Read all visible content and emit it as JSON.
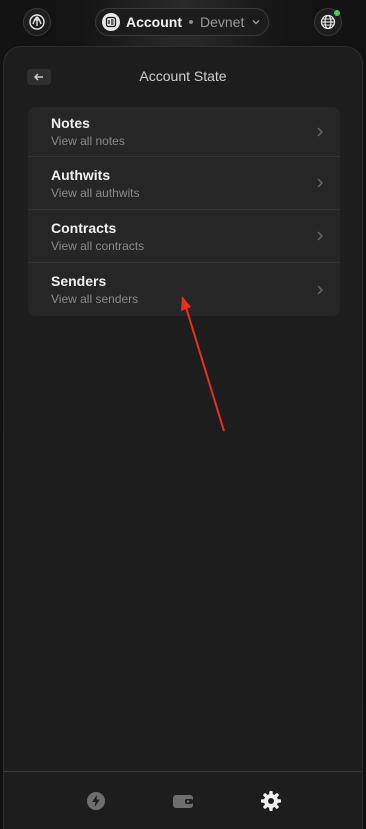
{
  "topbar": {
    "account_label": "Account",
    "network_label": "Devnet",
    "logo_icon": "aztec-logo-icon",
    "globe_icon": "globe-icon",
    "status_color": "#3ecf5c"
  },
  "panel": {
    "title": "Account State",
    "back_icon": "arrow-left-icon"
  },
  "menu": {
    "items": [
      {
        "title": "Notes",
        "subtitle": "View all notes"
      },
      {
        "title": "Authwits",
        "subtitle": "View all authwits"
      },
      {
        "title": "Contracts",
        "subtitle": "View all contracts"
      },
      {
        "title": "Senders",
        "subtitle": "View all senders"
      }
    ]
  },
  "nav": {
    "items": [
      "lightning-icon",
      "wallet-icon",
      "gear-icon"
    ],
    "active": "gear-icon"
  },
  "annotation_color": "#e8301c"
}
